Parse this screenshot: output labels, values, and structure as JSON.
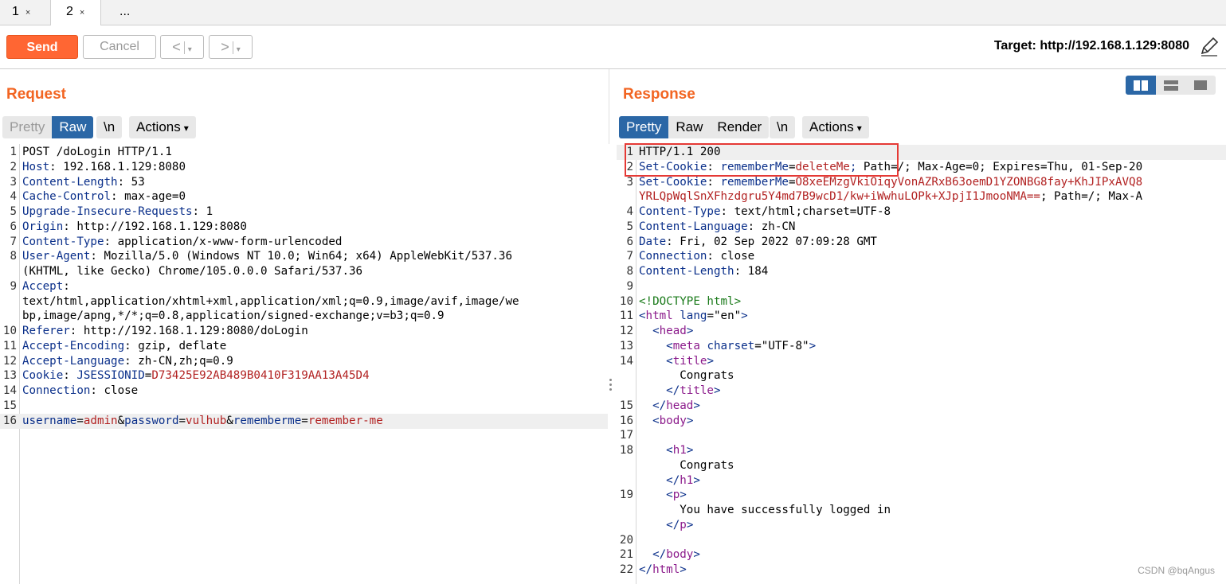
{
  "tabs": [
    {
      "label": "1",
      "close": "×"
    },
    {
      "label": "2",
      "close": "×"
    },
    {
      "label": "..."
    }
  ],
  "toolbar": {
    "send": "Send",
    "cancel": "Cancel",
    "back": "<",
    "forward": ">",
    "dropdown": "▾",
    "target": "Target: http://192.168.1.129:8080"
  },
  "request": {
    "title": "Request",
    "view_tabs": [
      "Pretty",
      "Raw"
    ],
    "newline_btn": "\\n",
    "actions": "Actions",
    "lines": [
      {
        "n": "1",
        "t": [
          [
            "v",
            "POST /doLogin HTTP/1.1"
          ]
        ]
      },
      {
        "n": "2",
        "t": [
          [
            "k",
            "Host"
          ],
          [
            "v",
            ": 192.168.1.129:8080"
          ]
        ]
      },
      {
        "n": "3",
        "t": [
          [
            "k",
            "Content-Length"
          ],
          [
            "v",
            ": 53"
          ]
        ]
      },
      {
        "n": "4",
        "t": [
          [
            "k",
            "Cache-Control"
          ],
          [
            "v",
            ": max-age=0"
          ]
        ]
      },
      {
        "n": "5",
        "t": [
          [
            "k",
            "Upgrade-Insecure-Requests"
          ],
          [
            "v",
            ": 1"
          ]
        ]
      },
      {
        "n": "6",
        "t": [
          [
            "k",
            "Origin"
          ],
          [
            "v",
            ": http://192.168.1.129:8080"
          ]
        ]
      },
      {
        "n": "7",
        "t": [
          [
            "k",
            "Content-Type"
          ],
          [
            "v",
            ": application/x-www-form-urlencoded"
          ]
        ]
      },
      {
        "n": "8",
        "t": [
          [
            "k",
            "User-Agent"
          ],
          [
            "v",
            ": Mozilla/5.0 (Windows NT 10.0; Win64; x64) AppleWebKit/537.36"
          ]
        ]
      },
      {
        "n": "",
        "t": [
          [
            "v",
            "(KHTML, like Gecko) Chrome/105.0.0.0 Safari/537.36"
          ]
        ]
      },
      {
        "n": "9",
        "t": [
          [
            "k",
            "Accept"
          ],
          [
            "v",
            ":"
          ]
        ]
      },
      {
        "n": "",
        "t": [
          [
            "v",
            "text/html,application/xhtml+xml,application/xml;q=0.9,image/avif,image/we"
          ]
        ]
      },
      {
        "n": "",
        "t": [
          [
            "v",
            "bp,image/apng,*/*;q=0.8,application/signed-exchange;v=b3;q=0.9"
          ]
        ]
      },
      {
        "n": "10",
        "t": [
          [
            "k",
            "Referer"
          ],
          [
            "v",
            ": http://192.168.1.129:8080/doLogin"
          ]
        ]
      },
      {
        "n": "11",
        "t": [
          [
            "k",
            "Accept-Encoding"
          ],
          [
            "v",
            ": gzip, deflate"
          ]
        ]
      },
      {
        "n": "12",
        "t": [
          [
            "k",
            "Accept-Language"
          ],
          [
            "v",
            ": zh-CN,zh;q=0.9"
          ]
        ]
      },
      {
        "n": "13",
        "t": [
          [
            "k",
            "Cookie"
          ],
          [
            "v",
            ": "
          ],
          [
            "k",
            "JSESSIONID"
          ],
          [
            "v",
            "="
          ],
          [
            "red",
            "D73425E92AB489B0410F319AA13A45D4"
          ]
        ]
      },
      {
        "n": "14",
        "t": [
          [
            "k",
            "Connection"
          ],
          [
            "v",
            ": close"
          ]
        ]
      },
      {
        "n": "15",
        "t": []
      },
      {
        "n": "16",
        "hl": true,
        "t": [
          [
            "k",
            "username"
          ],
          [
            "v",
            "="
          ],
          [
            "red",
            "admin"
          ],
          [
            "v",
            "&"
          ],
          [
            "k",
            "password"
          ],
          [
            "v",
            "="
          ],
          [
            "red",
            "vulhub"
          ],
          [
            "v",
            "&"
          ],
          [
            "k",
            "rememberme"
          ],
          [
            "v",
            "="
          ],
          [
            "red",
            "remember-me"
          ]
        ]
      }
    ]
  },
  "response": {
    "title": "Response",
    "view_tabs": [
      "Pretty",
      "Raw",
      "Render"
    ],
    "newline_btn": "\\n",
    "actions": "Actions",
    "lines": [
      {
        "n": "1",
        "hl": true,
        "t": [
          [
            "v",
            "HTTP/1.1 200"
          ]
        ]
      },
      {
        "n": "2",
        "t": [
          [
            "k",
            "Set-Cookie"
          ],
          [
            "v",
            ": "
          ],
          [
            "k",
            "rememberMe"
          ],
          [
            "v",
            "="
          ],
          [
            "red",
            "deleteMe"
          ],
          [
            "k",
            ";"
          ],
          [
            "v",
            " Path=/; Max-Age=0; Expires=Thu, 01-Sep-20"
          ]
        ]
      },
      {
        "n": "3",
        "t": [
          [
            "k",
            "Set-Cookie"
          ],
          [
            "v",
            ": "
          ],
          [
            "k",
            "rememberMe"
          ],
          [
            "v",
            "="
          ],
          [
            "red",
            "O8xeEMzgVkiOiqyVonAZRxB63oemD1YZONBG8fay+KhJIPxAVQ8"
          ]
        ]
      },
      {
        "n": "",
        "t": [
          [
            "red",
            "YRLQpWqlSnXFhzdgru5Y4md7B9wcD1/kw+iWwhuLOPk+XJpjI1JmooNMA=="
          ],
          [
            "v",
            "; Path=/; Max-A"
          ]
        ]
      },
      {
        "n": "4",
        "t": [
          [
            "k",
            "Content-Type"
          ],
          [
            "v",
            ": text/html;charset=UTF-8"
          ]
        ]
      },
      {
        "n": "5",
        "t": [
          [
            "k",
            "Content-Language"
          ],
          [
            "v",
            ": zh-CN"
          ]
        ]
      },
      {
        "n": "6",
        "t": [
          [
            "k",
            "Date"
          ],
          [
            "v",
            ": Fri, 02 Sep 2022 07:09:28 GMT"
          ]
        ]
      },
      {
        "n": "7",
        "t": [
          [
            "k",
            "Connection"
          ],
          [
            "v",
            ": close"
          ]
        ]
      },
      {
        "n": "8",
        "t": [
          [
            "k",
            "Content-Length"
          ],
          [
            "v",
            ": 184"
          ]
        ]
      },
      {
        "n": "9",
        "t": []
      },
      {
        "n": "10",
        "t": [
          [
            "cmt",
            "<!DOCTYPE html>"
          ]
        ]
      },
      {
        "n": "11",
        "t": [
          [
            "k",
            "<"
          ],
          [
            "tag",
            "html"
          ],
          [
            "v",
            " "
          ],
          [
            "k",
            "lang"
          ],
          [
            "v",
            "="
          ],
          [
            "str",
            "\"en\""
          ],
          [
            "k",
            ">"
          ]
        ]
      },
      {
        "n": "12",
        "t": [
          [
            "v",
            "  "
          ],
          [
            "k",
            "<"
          ],
          [
            "tag",
            "head"
          ],
          [
            "k",
            ">"
          ]
        ]
      },
      {
        "n": "13",
        "t": [
          [
            "v",
            "    "
          ],
          [
            "k",
            "<"
          ],
          [
            "tag",
            "meta"
          ],
          [
            "v",
            " "
          ],
          [
            "k",
            "charset"
          ],
          [
            "v",
            "="
          ],
          [
            "str",
            "\"UTF-8\""
          ],
          [
            "k",
            ">"
          ]
        ]
      },
      {
        "n": "14",
        "t": [
          [
            "v",
            "    "
          ],
          [
            "k",
            "<"
          ],
          [
            "tag",
            "title"
          ],
          [
            "k",
            ">"
          ]
        ]
      },
      {
        "n": "",
        "t": [
          [
            "v",
            "      Congrats"
          ]
        ]
      },
      {
        "n": "",
        "t": [
          [
            "v",
            "    "
          ],
          [
            "k",
            "</"
          ],
          [
            "tag",
            "title"
          ],
          [
            "k",
            ">"
          ]
        ]
      },
      {
        "n": "15",
        "t": [
          [
            "v",
            "  "
          ],
          [
            "k",
            "</"
          ],
          [
            "tag",
            "head"
          ],
          [
            "k",
            ">"
          ]
        ]
      },
      {
        "n": "16",
        "t": [
          [
            "v",
            "  "
          ],
          [
            "k",
            "<"
          ],
          [
            "tag",
            "body"
          ],
          [
            "k",
            ">"
          ]
        ]
      },
      {
        "n": "17",
        "t": []
      },
      {
        "n": "18",
        "t": [
          [
            "v",
            "    "
          ],
          [
            "k",
            "<"
          ],
          [
            "tag",
            "h1"
          ],
          [
            "k",
            ">"
          ]
        ]
      },
      {
        "n": "",
        "t": [
          [
            "v",
            "      Congrats"
          ]
        ]
      },
      {
        "n": "",
        "t": [
          [
            "v",
            "    "
          ],
          [
            "k",
            "</"
          ],
          [
            "tag",
            "h1"
          ],
          [
            "k",
            ">"
          ]
        ]
      },
      {
        "n": "19",
        "t": [
          [
            "v",
            "    "
          ],
          [
            "k",
            "<"
          ],
          [
            "tag",
            "p"
          ],
          [
            "k",
            ">"
          ]
        ]
      },
      {
        "n": "",
        "t": [
          [
            "v",
            "      You have successfully logged in"
          ]
        ]
      },
      {
        "n": "",
        "t": [
          [
            "v",
            "    "
          ],
          [
            "k",
            "</"
          ],
          [
            "tag",
            "p"
          ],
          [
            "k",
            ">"
          ]
        ]
      },
      {
        "n": "20",
        "t": []
      },
      {
        "n": "21",
        "t": [
          [
            "v",
            "  "
          ],
          [
            "k",
            "</"
          ],
          [
            "tag",
            "body"
          ],
          [
            "k",
            ">"
          ]
        ]
      },
      {
        "n": "22",
        "t": [
          [
            "k",
            "</"
          ],
          [
            "tag",
            "html"
          ],
          [
            "k",
            ">"
          ]
        ]
      }
    ]
  },
  "watermark": "CSDN @bqAngus",
  "colors": {
    "accent": "#ff6633",
    "title": "#f26522",
    "selected": "#2b67a6",
    "highlight_box": "#e53935"
  }
}
